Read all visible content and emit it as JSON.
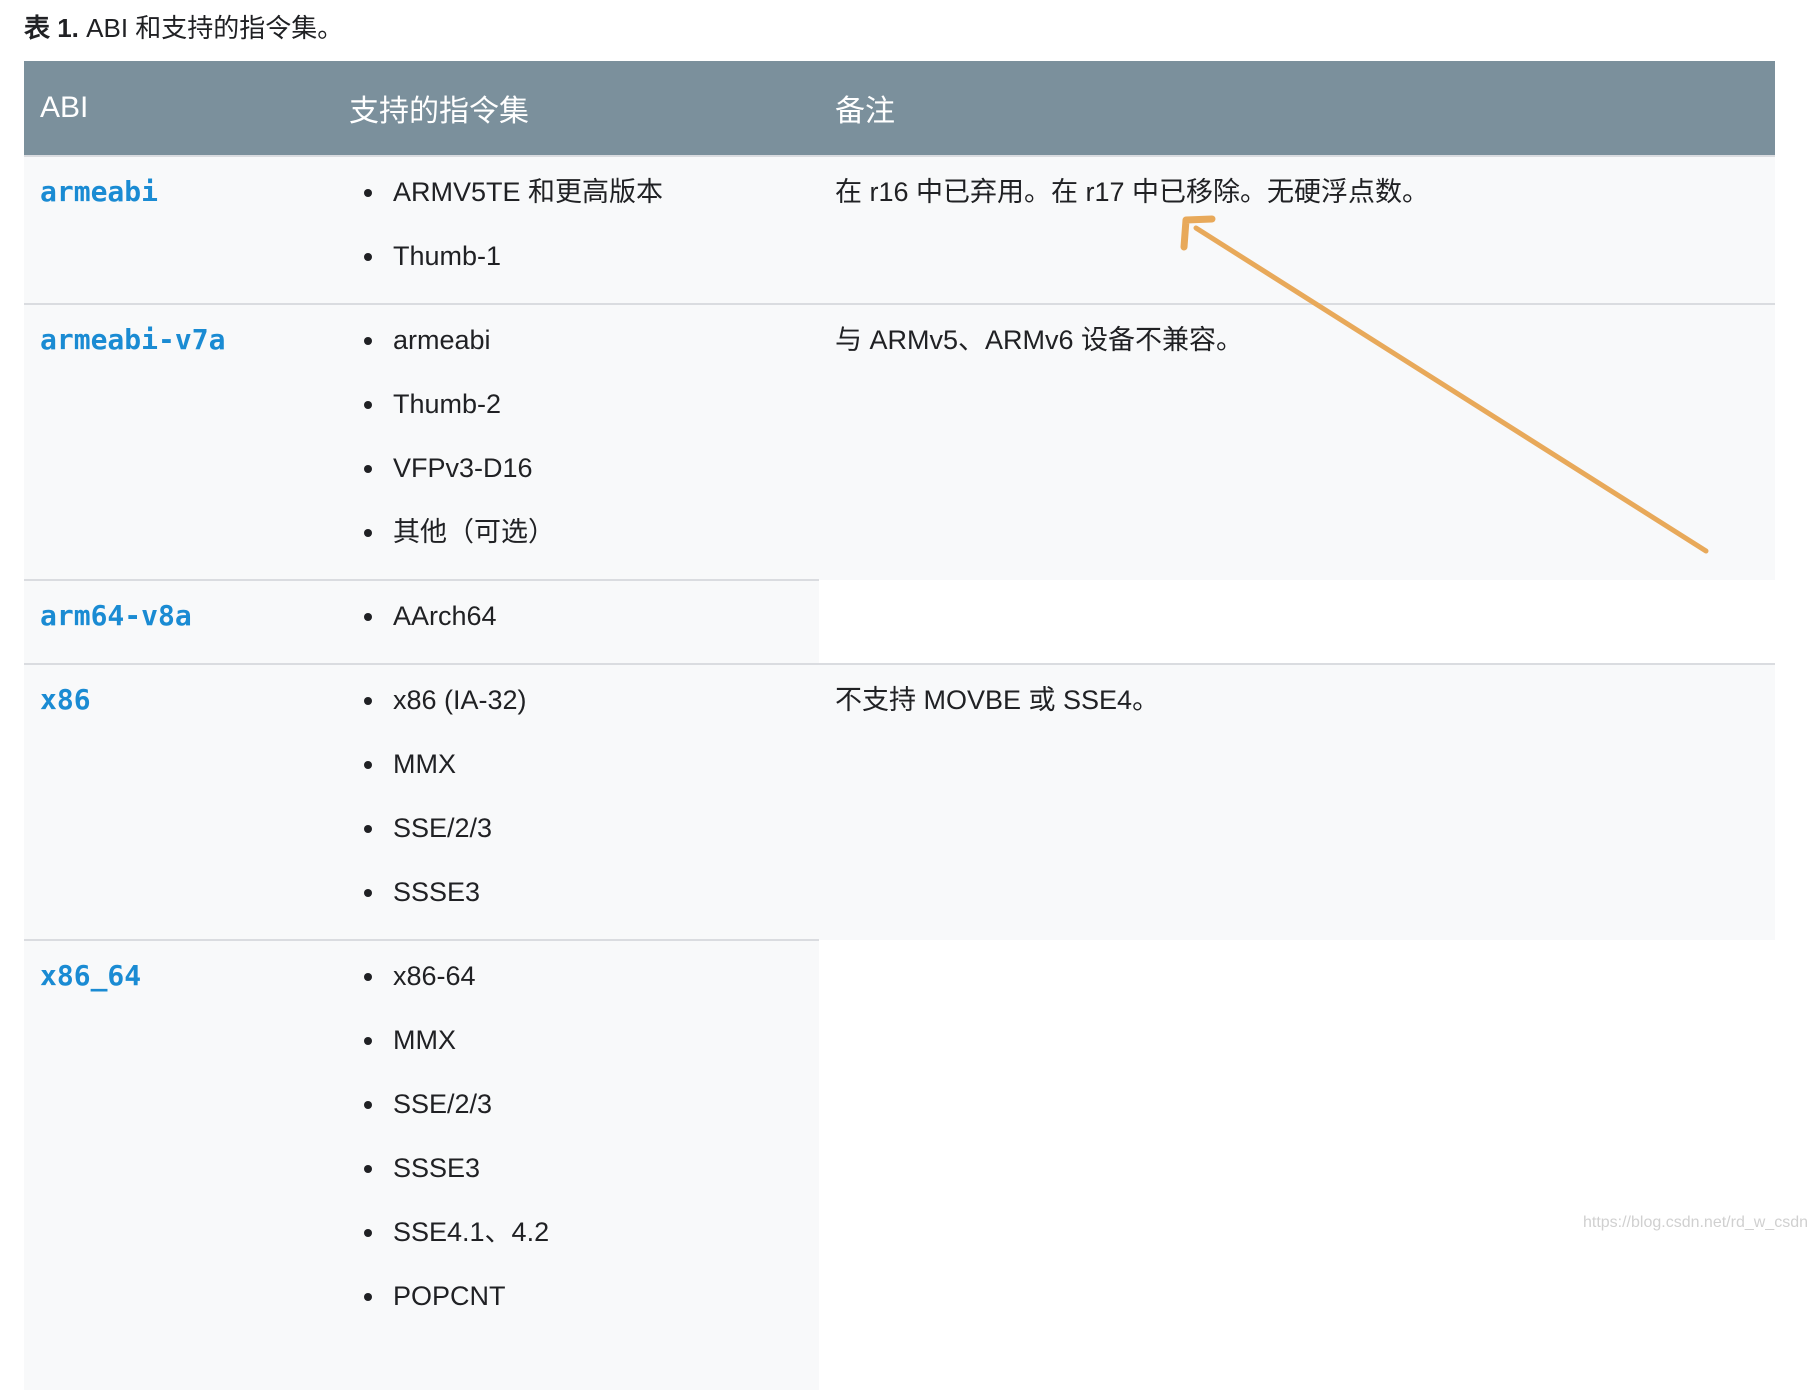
{
  "caption": {
    "prefix": "表 1.",
    "text": "ABI 和支持的指令集。"
  },
  "headers": {
    "abi": "ABI",
    "isa": "支持的指令集",
    "note": "备注"
  },
  "rows": [
    {
      "abi": "armeabi",
      "isa": [
        "ARMV5TE 和更高版本",
        "Thumb-1"
      ],
      "note": "在 r16 中已弃用。在 r17 中已移除。无硬浮点数。"
    },
    {
      "abi": "armeabi-v7a",
      "isa": [
        "armeabi",
        "Thumb-2",
        "VFPv3-D16",
        "其他（可选）"
      ],
      "note": "与 ARMv5、ARMv6 设备不兼容。"
    },
    {
      "abi": "arm64-v8a",
      "isa": [
        "AArch64"
      ],
      "note": ""
    },
    {
      "abi": "x86",
      "isa": [
        "x86 (IA-32)",
        "MMX",
        "SSE/2/3",
        "SSSE3"
      ],
      "note": "不支持 MOVBE 或 SSE4。"
    },
    {
      "abi": "x86_64",
      "isa": [
        "x86-64",
        "MMX",
        "SSE/2/3",
        "SSSE3",
        "SSE4.1、4.2",
        "POPCNT"
      ],
      "note": ""
    }
  ],
  "watermark": "https://blog.csdn.net/rd_w_csdn",
  "colors": {
    "header_bg": "#7b909c",
    "abi_link": "#1a8bd3",
    "arrow": "#e8a95a",
    "row_shade": "#f8f9fa"
  }
}
